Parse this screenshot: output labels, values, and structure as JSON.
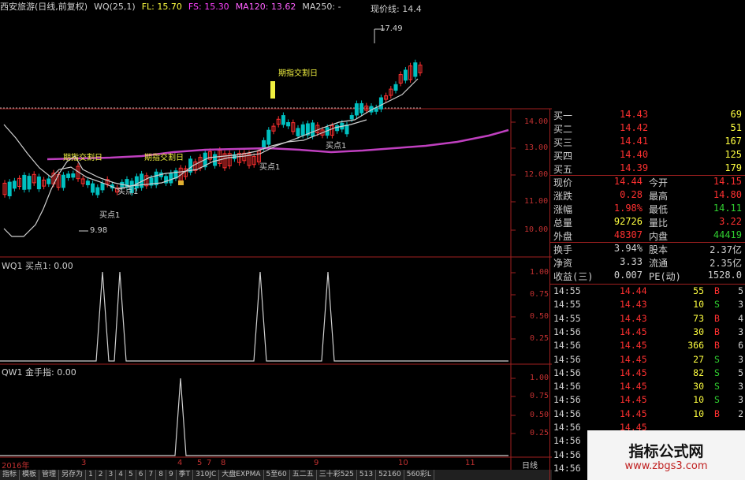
{
  "header": {
    "stock": "西安旅游(日线,前复权)",
    "indicator": "WQ(25,1)",
    "fl": "FL: 15.70",
    "fs": "FS: 15.30",
    "ma120": "MA120: 13.62",
    "ma250": "MA250: -",
    "current": "现价线: 14.4"
  },
  "chart_annotations": {
    "high_label": "17.49",
    "low_label": "9.98",
    "delivery1": "期指交割日",
    "delivery2": "期指交割日",
    "delivery3": "期指交割日",
    "buy1a": "买点1",
    "buy1b": "买点1",
    "buy1c": "买点1",
    "buy1d": "买点1"
  },
  "price_axis": [
    "14.00",
    "13.00",
    "12.00",
    "11.00",
    "10.00"
  ],
  "sub1": {
    "title": "WQ1  买点1: 0.00",
    "axis": [
      "1.00",
      "0.75",
      "0.50",
      "0.25"
    ]
  },
  "sub2": {
    "title": "QW1  金手指: 0.00",
    "axis": [
      "1.00",
      "0.75",
      "0.50",
      "0.25"
    ]
  },
  "date_axis": {
    "year": "2016年",
    "m3": "3",
    "m4": "4",
    "m5": "5",
    "m7": "7",
    "m8": "8",
    "m9": "9",
    "m10": "10",
    "m11": "11",
    "right": "日线"
  },
  "bids": [
    {
      "label": "买一",
      "price": "14.43",
      "vol": "69"
    },
    {
      "label": "买二",
      "price": "14.42",
      "vol": "51"
    },
    {
      "label": "买三",
      "price": "14.41",
      "vol": "167"
    },
    {
      "label": "买四",
      "price": "14.40",
      "vol": "125"
    },
    {
      "label": "买五",
      "price": "14.39",
      "vol": "179"
    }
  ],
  "quote": [
    {
      "l1": "现价",
      "v1": "14.44",
      "l2": "今开",
      "v2": "14.15"
    },
    {
      "l1": "涨跌",
      "v1": "0.28",
      "l2": "最高",
      "v2": "14.80"
    },
    {
      "l1": "涨幅",
      "v1": "1.98%",
      "l2": "最低",
      "v2": "14.11"
    },
    {
      "l1": "总量",
      "v1": "92726",
      "l2": "量比",
      "v2": "3.22"
    },
    {
      "l1": "外盘",
      "v1": "48307",
      "l2": "内盘",
      "v2": "44419"
    }
  ],
  "fundamentals": [
    {
      "l1": "换手",
      "v1": "3.94%",
      "l2": "股本",
      "v2": "2.37亿"
    },
    {
      "l1": "净资",
      "v1": "3.33",
      "l2": "流通",
      "v2": "2.35亿"
    },
    {
      "l1": "收益(三)",
      "v1": "0.007",
      "l2": "PE(动)",
      "v2": "1528.0"
    }
  ],
  "ticks": [
    {
      "t": "14:55",
      "p": "14.44",
      "v": "55",
      "d": "B",
      "n": "5"
    },
    {
      "t": "14:55",
      "p": "14.43",
      "v": "10",
      "d": "S",
      "n": "3"
    },
    {
      "t": "14:55",
      "p": "14.43",
      "v": "73",
      "d": "B",
      "n": "4"
    },
    {
      "t": "14:56",
      "p": "14.45",
      "v": "30",
      "d": "B",
      "n": "3"
    },
    {
      "t": "14:56",
      "p": "14.45",
      "v": "366",
      "d": "B",
      "n": "6"
    },
    {
      "t": "14:56",
      "p": "14.45",
      "v": "27",
      "d": "S",
      "n": "3"
    },
    {
      "t": "14:56",
      "p": "14.45",
      "v": "82",
      "d": "S",
      "n": "5"
    },
    {
      "t": "14:56",
      "p": "14.45",
      "v": "30",
      "d": "S",
      "n": "3"
    },
    {
      "t": "14:56",
      "p": "14.45",
      "v": "10",
      "d": "S",
      "n": "3"
    },
    {
      "t": "14:56",
      "p": "14.45",
      "v": "10",
      "d": "B",
      "n": "2"
    },
    {
      "t": "14:56",
      "p": "14.45",
      "v": "",
      "d": "",
      "n": ""
    },
    {
      "t": "14:56",
      "p": "14.44",
      "v": "",
      "d": "",
      "n": ""
    },
    {
      "t": "14:56",
      "p": "14.44",
      "v": "",
      "d": "",
      "n": ""
    },
    {
      "t": "14:56",
      "p": "",
      "v": "",
      "d": "",
      "n": ""
    }
  ],
  "tabs": [
    "指标",
    "模板",
    "管理",
    "另存为",
    "1",
    "2",
    "3",
    "4",
    "5",
    "6",
    "7",
    "8",
    "9",
    "季T",
    "310JC",
    "大盘EXPMA",
    "5至60",
    "五二五",
    "三十彩525",
    "513",
    "52160",
    "560彩L"
  ],
  "watermark": {
    "line1": "指标公式网",
    "line2": "www.zbgs3.com"
  },
  "colors": {
    "up": "#ff3030",
    "down": "#00c0c0",
    "ma_purple": "#c040c0",
    "white": "#d0d0d0",
    "green": "#30d030"
  }
}
